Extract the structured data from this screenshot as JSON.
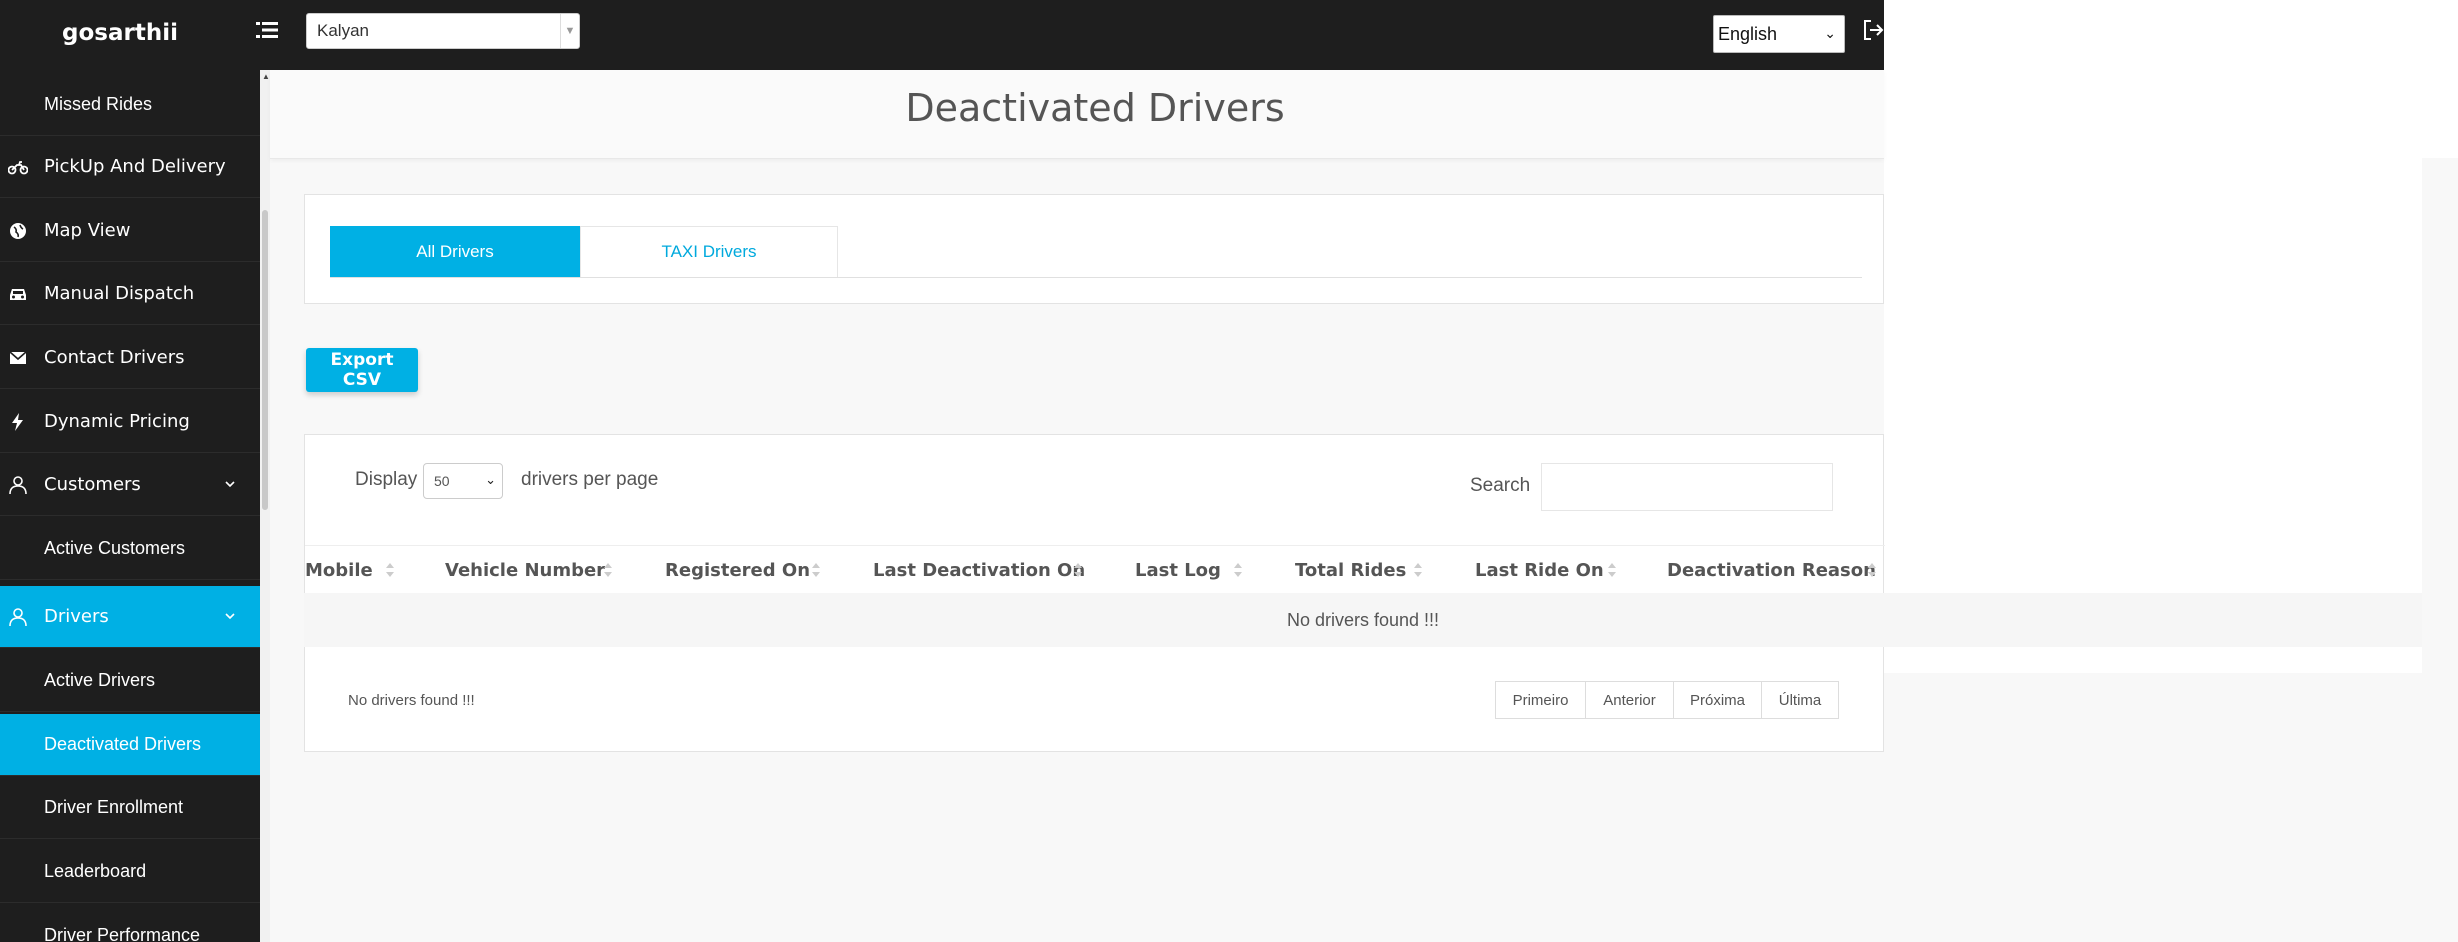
{
  "app": {
    "brand": "gosarthii"
  },
  "topbar": {
    "city": "Kalyan",
    "language": "English"
  },
  "sidebar": {
    "items": [
      {
        "label": "Missed Rides",
        "icon": "none",
        "type": "sub"
      },
      {
        "label": "PickUp And Delivery",
        "icon": "motorcycle-icon",
        "type": "main"
      },
      {
        "label": "Map View",
        "icon": "globe-icon",
        "type": "main"
      },
      {
        "label": "Manual Dispatch",
        "icon": "car-icon",
        "type": "main"
      },
      {
        "label": "Contact Drivers",
        "icon": "envelope-icon",
        "type": "main"
      },
      {
        "label": "Dynamic Pricing",
        "icon": "bolt-icon",
        "type": "main"
      },
      {
        "label": "Customers",
        "icon": "user-icon",
        "type": "main",
        "expandable": true
      },
      {
        "label": "Active Customers",
        "icon": "none",
        "type": "sub"
      },
      {
        "label": "Drivers",
        "icon": "user-icon",
        "type": "main",
        "expandable": true,
        "active": true
      },
      {
        "label": "Active Drivers",
        "icon": "none",
        "type": "sub"
      },
      {
        "label": "Deactivated Drivers",
        "icon": "none",
        "type": "sub",
        "active": true
      },
      {
        "label": "Driver Enrollment",
        "icon": "none",
        "type": "sub"
      },
      {
        "label": "Leaderboard",
        "icon": "none",
        "type": "sub"
      },
      {
        "label": "Driver Performance",
        "icon": "none",
        "type": "sub"
      }
    ]
  },
  "page": {
    "title": "Deactivated Drivers",
    "tabs": [
      {
        "label": "All Drivers",
        "active": true
      },
      {
        "label": "TAXI Drivers",
        "active": false
      }
    ],
    "export_label": "Export CSV"
  },
  "table": {
    "display_label": "Display",
    "page_length": "50",
    "per_page_label": "drivers per page",
    "search_label": "Search",
    "columns": [
      "Mobile",
      "Vehicle Number",
      "Registered On",
      "Last Deactivation On",
      "Last Log",
      "Total Rides",
      "Last Ride On",
      "Deactivation Reason"
    ],
    "empty_message": "No drivers found !!!",
    "info": "No drivers found !!!",
    "pagination": [
      "Primeiro",
      "Anterior",
      "Próxima",
      "Última"
    ]
  },
  "colors": {
    "accent": "#00b0e4",
    "dark": "#1e1e1e"
  }
}
